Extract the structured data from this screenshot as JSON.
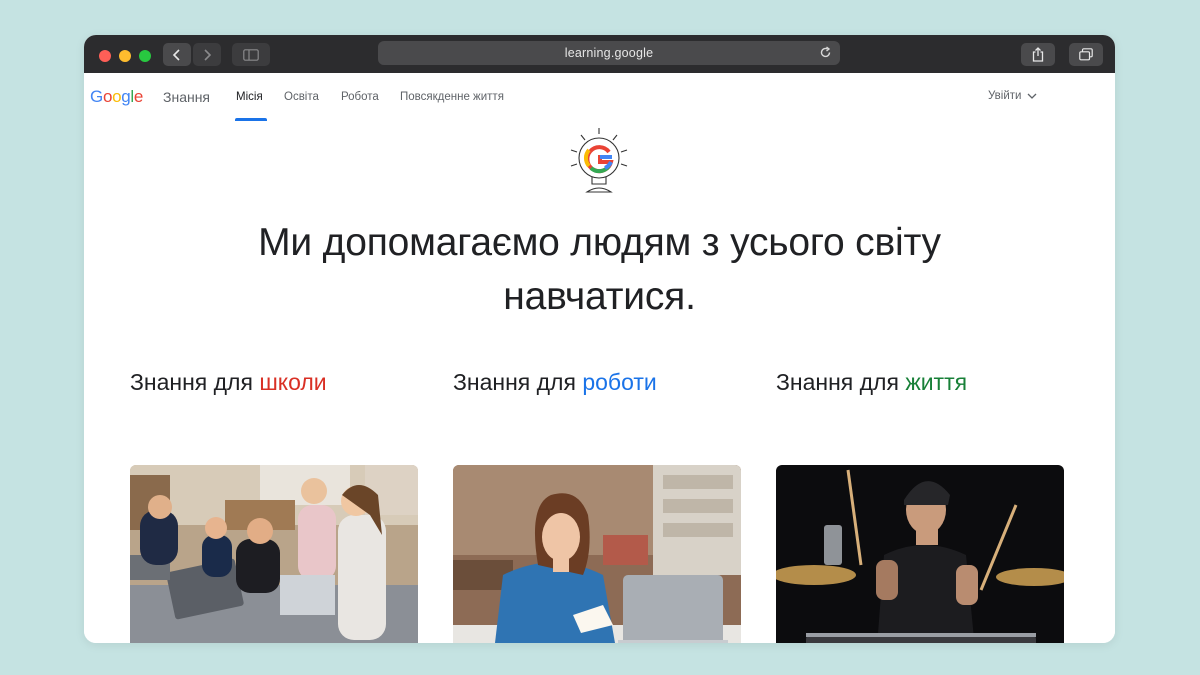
{
  "browser": {
    "url": "learning.google"
  },
  "nav": {
    "brand": "Знання",
    "links": [
      "Місія",
      "Освіта",
      "Робота",
      "Повсякденне життя"
    ],
    "signin": "Увійти"
  },
  "hero": {
    "line1": "Ми допомагаємо людям з усього світу",
    "line2": "навчатися."
  },
  "cards": [
    {
      "prefix": "Знання для ",
      "accent": "школи"
    },
    {
      "prefix": "Знання для ",
      "accent": "роботи"
    },
    {
      "prefix": "Знання для ",
      "accent": "життя"
    }
  ],
  "colors": {
    "school": "#d93025",
    "work": "#1a73e8",
    "life": "#188038"
  }
}
